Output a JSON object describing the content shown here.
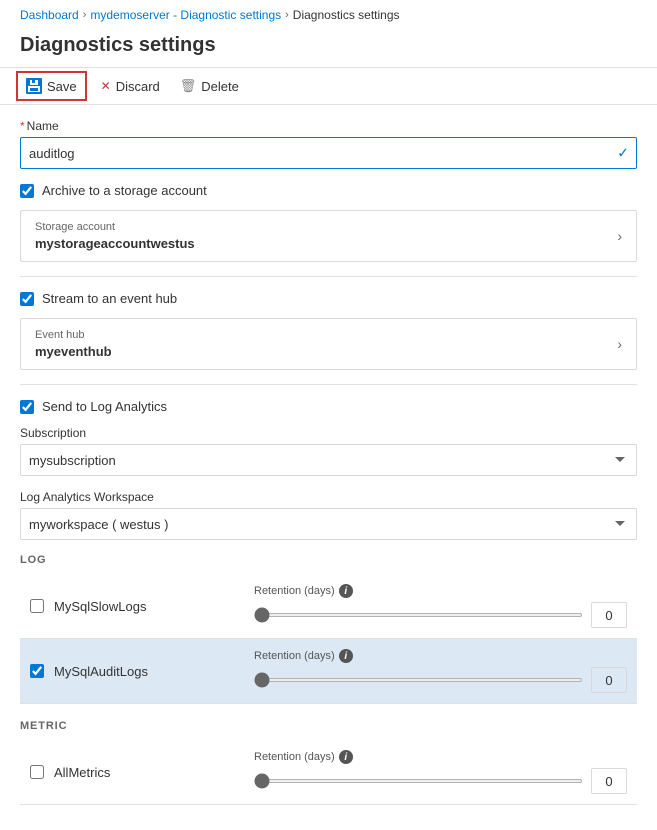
{
  "breadcrumb": {
    "items": [
      {
        "label": "Dashboard",
        "link": true
      },
      {
        "label": "mydemoserver - Diagnostic settings",
        "link": true
      },
      {
        "label": "Diagnostics settings",
        "link": false
      }
    ]
  },
  "page": {
    "title": "Diagnostics settings"
  },
  "toolbar": {
    "save_label": "Save",
    "discard_label": "Discard",
    "delete_label": "Delete"
  },
  "form": {
    "name_label": "Name",
    "name_required": "*",
    "name_value": "auditlog",
    "archive_label": "Archive to a storage account",
    "archive_checked": true,
    "storage_account_label": "Storage account",
    "storage_account_value": "mystorageaccountwestus",
    "stream_label": "Stream to an event hub",
    "stream_checked": true,
    "event_hub_label": "Event hub",
    "event_hub_value": "myeventhub",
    "log_analytics_label": "Send to Log Analytics",
    "log_analytics_checked": true,
    "subscription_label": "Subscription",
    "subscription_value": "mysubscription",
    "workspace_label": "Log Analytics Workspace",
    "workspace_value": "myworkspace ( westus )"
  },
  "log_section": {
    "header": "LOG",
    "rows": [
      {
        "name": "MySqlSlowLogs",
        "checked": false,
        "retention_days": 0,
        "highlighted": false
      },
      {
        "name": "MySqlAuditLogs",
        "checked": true,
        "retention_days": 0,
        "highlighted": true
      }
    ]
  },
  "metric_section": {
    "header": "METRIC",
    "rows": [
      {
        "name": "AllMetrics",
        "checked": false,
        "retention_days": 0,
        "highlighted": false
      }
    ]
  },
  "labels": {
    "retention_days": "Retention (days)"
  }
}
